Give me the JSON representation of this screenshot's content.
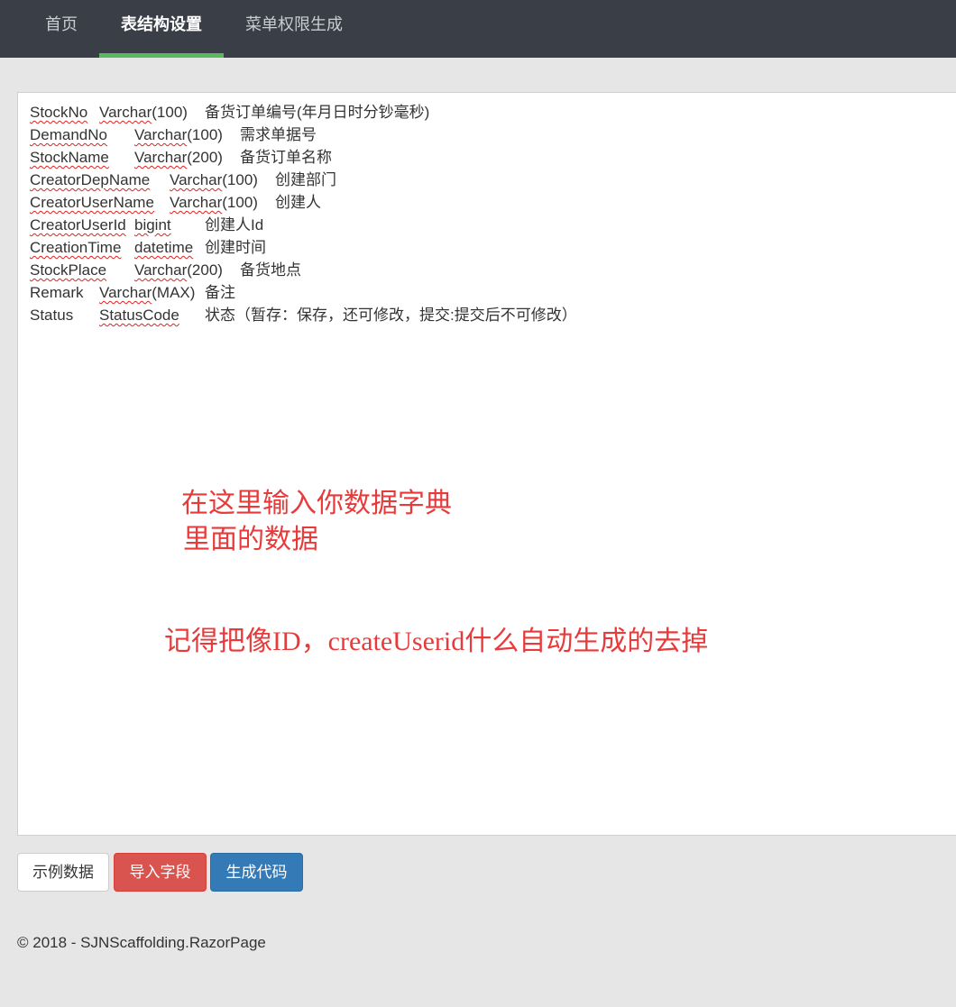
{
  "navbar": {
    "items": [
      {
        "label": "首页"
      },
      {
        "label": "表结构设置"
      },
      {
        "label": "菜单权限生成"
      }
    ],
    "active_index": 1,
    "accent_color": "#5cb85c"
  },
  "editor": {
    "rows": [
      {
        "name": "StockNo",
        "type_name": "Varchar",
        "type_size": "(100)",
        "desc": "备货订单编号(年月日时分钞毫秒)"
      },
      {
        "name": "DemandNo",
        "type_name": "Varchar",
        "type_size": "(100)",
        "desc": "需求单据号"
      },
      {
        "name": "StockName",
        "type_name": "Varchar",
        "type_size": "(200)",
        "desc": "备货订单名称"
      },
      {
        "name": "CreatorDepName",
        "type_name": "Varchar",
        "type_size": "(100)",
        "desc": "创建部门"
      },
      {
        "name": "CreatorUserName",
        "type_name": "Varchar",
        "type_size": "(100)",
        "desc": "创建人"
      },
      {
        "name": "CreatorUserId",
        "type_name": "bigint",
        "type_size": "",
        "desc": "创建人Id"
      },
      {
        "name": "CreationTime",
        "type_name": "datetime",
        "type_size": "",
        "desc": "创建时间"
      },
      {
        "name": "StockPlace",
        "type_name": "Varchar",
        "type_size": "(200)",
        "desc": "备货地点"
      },
      {
        "name": "Remark",
        "type_name": "Varchar",
        "type_size": "(MAX)",
        "desc": "备注"
      },
      {
        "name": "Status",
        "type_name": "StatusCode",
        "type_size": "",
        "desc": "状态（暂存：保存，还可修改，提交:提交后不可修改）"
      }
    ]
  },
  "annotations": {
    "line1": "在这里输入你数据字典",
    "line2": "里面的数据",
    "line3": "记得把像ID，createUserid什么自动生成的去掉",
    "color": "#e83a3a"
  },
  "buttons": {
    "sample_label": "示例数据",
    "import_label": "导入字段",
    "generate_label": "生成代码"
  },
  "footer": {
    "text": "© 2018 - SJNScaffolding.RazorPage"
  }
}
